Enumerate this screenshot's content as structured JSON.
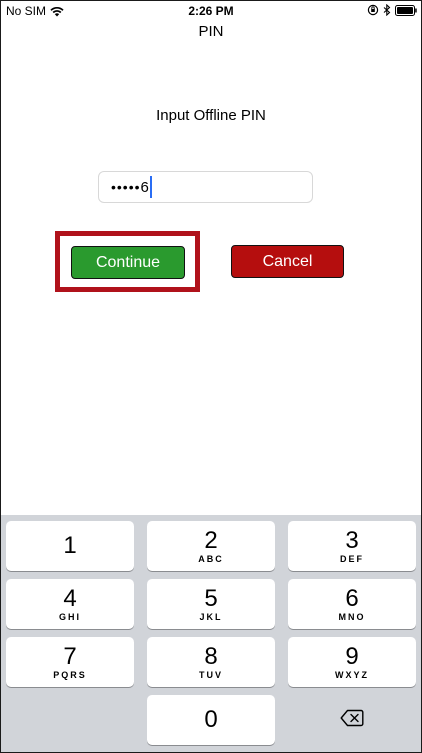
{
  "status_bar": {
    "carrier": "No SIM",
    "time": "2:26 PM",
    "icons": [
      "wifi-icon",
      "orientation-lock-icon",
      "bluetooth-icon",
      "battery-icon"
    ]
  },
  "page": {
    "title": "PIN",
    "prompt": "Input Offline PIN"
  },
  "pin_input": {
    "masked": "•••••",
    "last_char": "6"
  },
  "buttons": {
    "continue_label": "Continue",
    "cancel_label": "Cancel"
  },
  "colors": {
    "continue": "#2a9a2e",
    "cancel": "#b50e0e",
    "highlight": "#b0121b",
    "caret": "#2a6df4",
    "keyboard_bg": "#d1d4d9"
  },
  "keypad": {
    "keys": [
      {
        "num": "1",
        "letters": ""
      },
      {
        "num": "2",
        "letters": "ABC"
      },
      {
        "num": "3",
        "letters": "DEF"
      },
      {
        "num": "4",
        "letters": "GHI"
      },
      {
        "num": "5",
        "letters": "JKL"
      },
      {
        "num": "6",
        "letters": "MNO"
      },
      {
        "num": "7",
        "letters": "PQRS"
      },
      {
        "num": "8",
        "letters": "TUV"
      },
      {
        "num": "9",
        "letters": "WXYZ"
      },
      {
        "num": "0",
        "letters": ""
      }
    ],
    "delete_icon": "backspace-icon"
  }
}
